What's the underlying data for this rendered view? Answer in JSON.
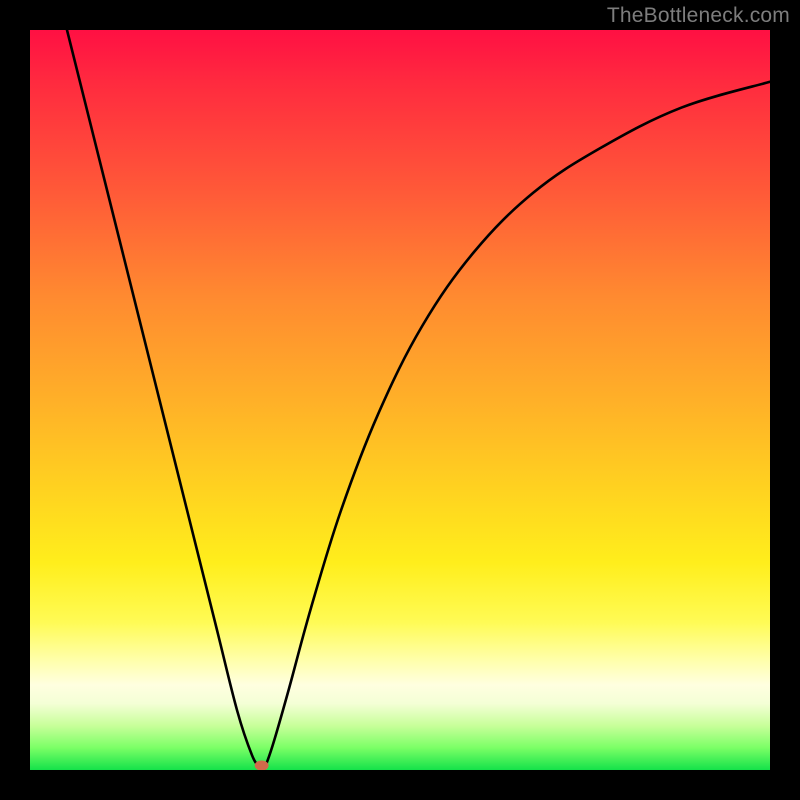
{
  "watermark": "TheBottleneck.com",
  "chart_data": {
    "type": "line",
    "title": "",
    "xlabel": "",
    "ylabel": "",
    "xlim": [
      0,
      100
    ],
    "ylim": [
      0,
      100
    ],
    "series": [
      {
        "name": "curve",
        "x": [
          5,
          10,
          15,
          20,
          25,
          28,
          30,
          31,
          31.5,
          32,
          33,
          35,
          38,
          42,
          47,
          53,
          60,
          68,
          77,
          88,
          100
        ],
        "values": [
          100,
          80,
          60,
          40,
          20,
          8,
          2,
          0.5,
          0,
          1,
          4,
          11,
          22,
          35,
          48,
          60,
          70,
          78,
          84,
          89.5,
          93
        ]
      }
    ],
    "marker": {
      "x": 31.3,
      "y": 0.6,
      "color": "#d06a4a"
    },
    "colors": {
      "curve": "#000000",
      "marker": "#d06a4a",
      "gradient_stops": [
        "#ff1043",
        "#ff5a38",
        "#ffb028",
        "#ffee1c",
        "#ffffe0",
        "#14e24a"
      ]
    }
  }
}
